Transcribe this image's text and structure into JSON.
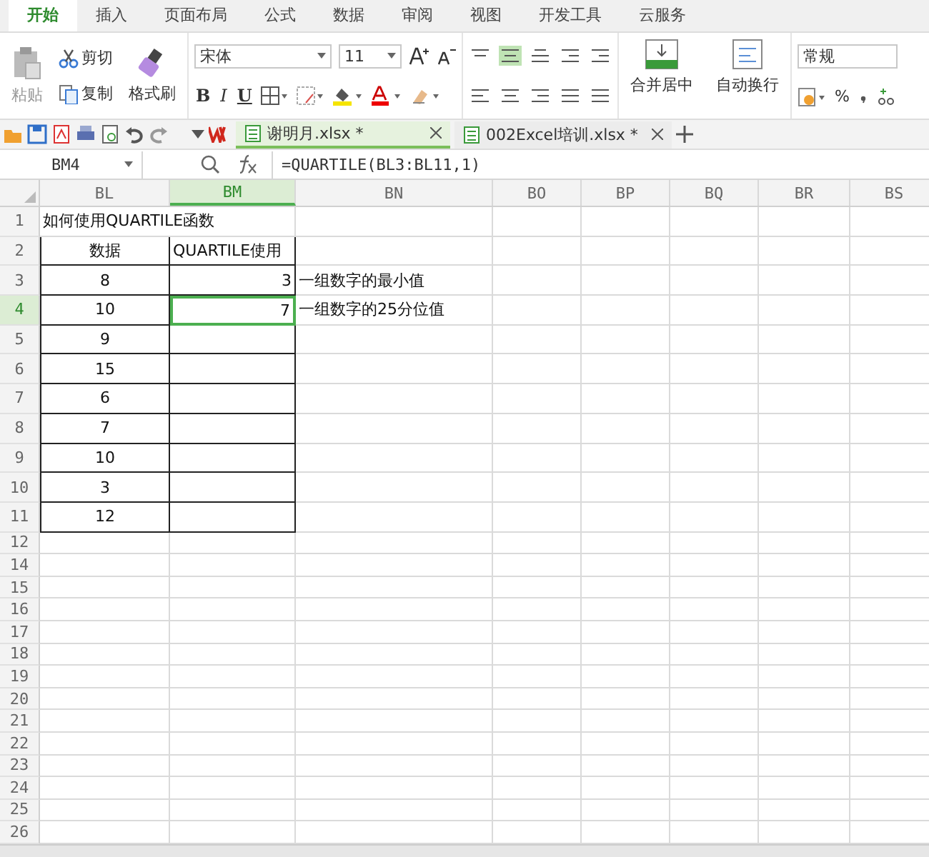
{
  "menu_tabs": [
    {
      "label": "开始",
      "selected": true
    },
    {
      "label": "插入",
      "selected": false
    },
    {
      "label": "页面布局",
      "selected": false
    },
    {
      "label": "公式",
      "selected": false
    },
    {
      "label": "数据",
      "selected": false
    },
    {
      "label": "审阅",
      "selected": false
    },
    {
      "label": "视图",
      "selected": false
    },
    {
      "label": "开发工具",
      "selected": false
    },
    {
      "label": "云服务",
      "selected": false
    }
  ],
  "ribbon": {
    "paste": "粘贴",
    "cut": "剪切",
    "copy": "复制",
    "format_painter": "格式刷",
    "font_name": "宋体",
    "font_size": "11",
    "bold": "B",
    "italic": "I",
    "underline": "U",
    "merge": "合并居中",
    "wrap": "自动换行",
    "number_format": "常规",
    "percent": "%"
  },
  "doc_tabs": [
    {
      "label": "谢明月.xlsx *",
      "selected": true
    },
    {
      "label": "002Excel培训.xlsx *",
      "selected": false
    }
  ],
  "name_box": "BM4",
  "formula": "=QUARTILE(BL3:BL11,1)",
  "columns": [
    {
      "label": "BL",
      "selected": false
    },
    {
      "label": "BM",
      "selected": true
    },
    {
      "label": "BN",
      "selected": false
    },
    {
      "label": "BO",
      "selected": false
    },
    {
      "label": "BP",
      "selected": false
    },
    {
      "label": "BQ",
      "selected": false
    },
    {
      "label": "BR",
      "selected": false
    },
    {
      "label": "BS",
      "selected": false
    }
  ],
  "rows": [
    {
      "number": "1",
      "selected": false,
      "in_table": false,
      "bm_active": false,
      "bl": "如何使用QUARTILE函数"
    },
    {
      "number": "2",
      "selected": false,
      "in_table": true,
      "bm_active": false,
      "bl": "数据",
      "bm": "QUARTILE使用"
    },
    {
      "number": "3",
      "selected": false,
      "in_table": true,
      "bm_active": false,
      "bl": "8",
      "bm": "3",
      "bn": "一组数字的最小值"
    },
    {
      "number": "4",
      "selected": true,
      "in_table": true,
      "bm_active": true,
      "bl": "10",
      "bm": "7",
      "bn": "一组数字的25分位值"
    },
    {
      "number": "5",
      "selected": false,
      "in_table": true,
      "bm_active": false,
      "bl": "9"
    },
    {
      "number": "6",
      "selected": false,
      "in_table": true,
      "bm_active": false,
      "bl": "15"
    },
    {
      "number": "7",
      "selected": false,
      "in_table": true,
      "bm_active": false,
      "bl": "6"
    },
    {
      "number": "8",
      "selected": false,
      "in_table": true,
      "bm_active": false,
      "bl": "7"
    },
    {
      "number": "9",
      "selected": false,
      "in_table": true,
      "bm_active": false,
      "bl": "10"
    },
    {
      "number": "10",
      "selected": false,
      "in_table": true,
      "bm_active": false,
      "bl": "3"
    },
    {
      "number": "11",
      "selected": false,
      "in_table": true,
      "bm_active": false,
      "bl": "12"
    },
    {
      "number": "12",
      "selected": false,
      "in_table": false,
      "bm_active": false
    },
    {
      "number": "14",
      "selected": false,
      "in_table": false,
      "bm_active": false
    },
    {
      "number": "15",
      "selected": false,
      "in_table": false,
      "bm_active": false
    },
    {
      "number": "16",
      "selected": false,
      "in_table": false,
      "bm_active": false
    },
    {
      "number": "17",
      "selected": false,
      "in_table": false,
      "bm_active": false
    },
    {
      "number": "18",
      "selected": false,
      "in_table": false,
      "bm_active": false
    },
    {
      "number": "19",
      "selected": false,
      "in_table": false,
      "bm_active": false
    },
    {
      "number": "20",
      "selected": false,
      "in_table": false,
      "bm_active": false
    },
    {
      "number": "21",
      "selected": false,
      "in_table": false,
      "bm_active": false
    },
    {
      "number": "22",
      "selected": false,
      "in_table": false,
      "bm_active": false
    },
    {
      "number": "23",
      "selected": false,
      "in_table": false,
      "bm_active": false
    },
    {
      "number": "24",
      "selected": false,
      "in_table": false,
      "bm_active": false
    },
    {
      "number": "25",
      "selected": false,
      "in_table": false,
      "bm_active": false
    },
    {
      "number": "26",
      "selected": false,
      "in_table": false,
      "bm_active": false
    }
  ]
}
